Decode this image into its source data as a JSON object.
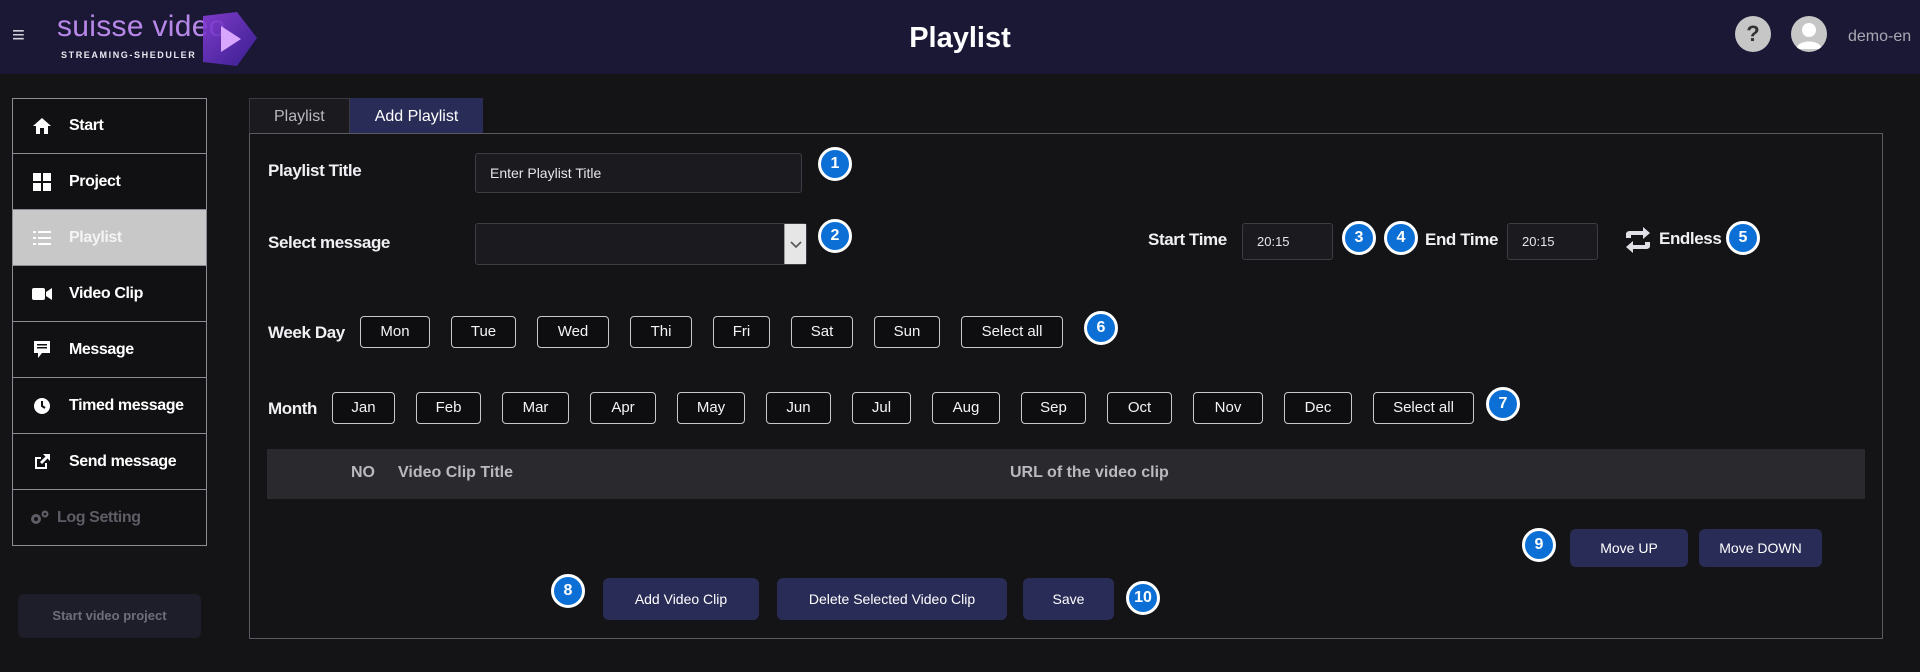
{
  "header": {
    "menu_icon": "hamburger-icon",
    "logo_text": "suisse video",
    "logo_subtitle": "STREAMING-SHEDULER",
    "title": "Playlist",
    "help_label": "?",
    "username": "demo-en"
  },
  "sidebar": {
    "items": [
      {
        "label": "Start",
        "icon": "home-icon"
      },
      {
        "label": "Project",
        "icon": "grid-icon"
      },
      {
        "label": "Playlist",
        "icon": "list-icon"
      },
      {
        "label": "Video Clip",
        "icon": "video-camera-icon"
      },
      {
        "label": "Message",
        "icon": "message-icon"
      },
      {
        "label": "Timed message",
        "icon": "clock-icon"
      },
      {
        "label": "Send message",
        "icon": "share-icon"
      },
      {
        "label": "Log Setting",
        "icon": "gears-icon"
      }
    ],
    "active_index": 2,
    "start_project_label": "Start video project"
  },
  "tabs": [
    {
      "label": "Playlist"
    },
    {
      "label": "Add Playlist"
    }
  ],
  "form": {
    "playlist_title_label": "Playlist Title",
    "playlist_title_value": "Enter Playlist Title",
    "select_message_label": "Select message",
    "select_message_value": "",
    "start_time_label": "Start Time",
    "start_time_value": "20:15",
    "end_time_label": "End Time",
    "end_time_value": "20:15",
    "endless_label": "Endless",
    "weekday_label": "Week Day",
    "weekdays": [
      "Mon",
      "Tue",
      "Wed",
      "Thi",
      "Fri",
      "Sat",
      "Sun"
    ],
    "weekday_select_all": "Select all",
    "month_label": "Month",
    "months": [
      "Jan",
      "Feb",
      "Mar",
      "Apr",
      "May",
      "Jun",
      "Jul",
      "Aug",
      "Sep",
      "Oct",
      "Nov",
      "Dec"
    ],
    "month_select_all": "Select all"
  },
  "table": {
    "columns": [
      "NO",
      "Video Clip Title",
      "URL of the video clip"
    ]
  },
  "actions": {
    "move_up": "Move UP",
    "move_down": "Move DOWN",
    "add_clip": "Add Video Clip",
    "delete_clip": "Delete Selected Video Clip",
    "save": "Save"
  },
  "badges": [
    "1",
    "2",
    "3",
    "4",
    "5",
    "6",
    "7",
    "8",
    "9",
    "10"
  ],
  "colors": {
    "header_bg": "#1a1835",
    "accent": "#2a2c58",
    "badge": "#0b6fd6",
    "logo": "#b888e8"
  }
}
